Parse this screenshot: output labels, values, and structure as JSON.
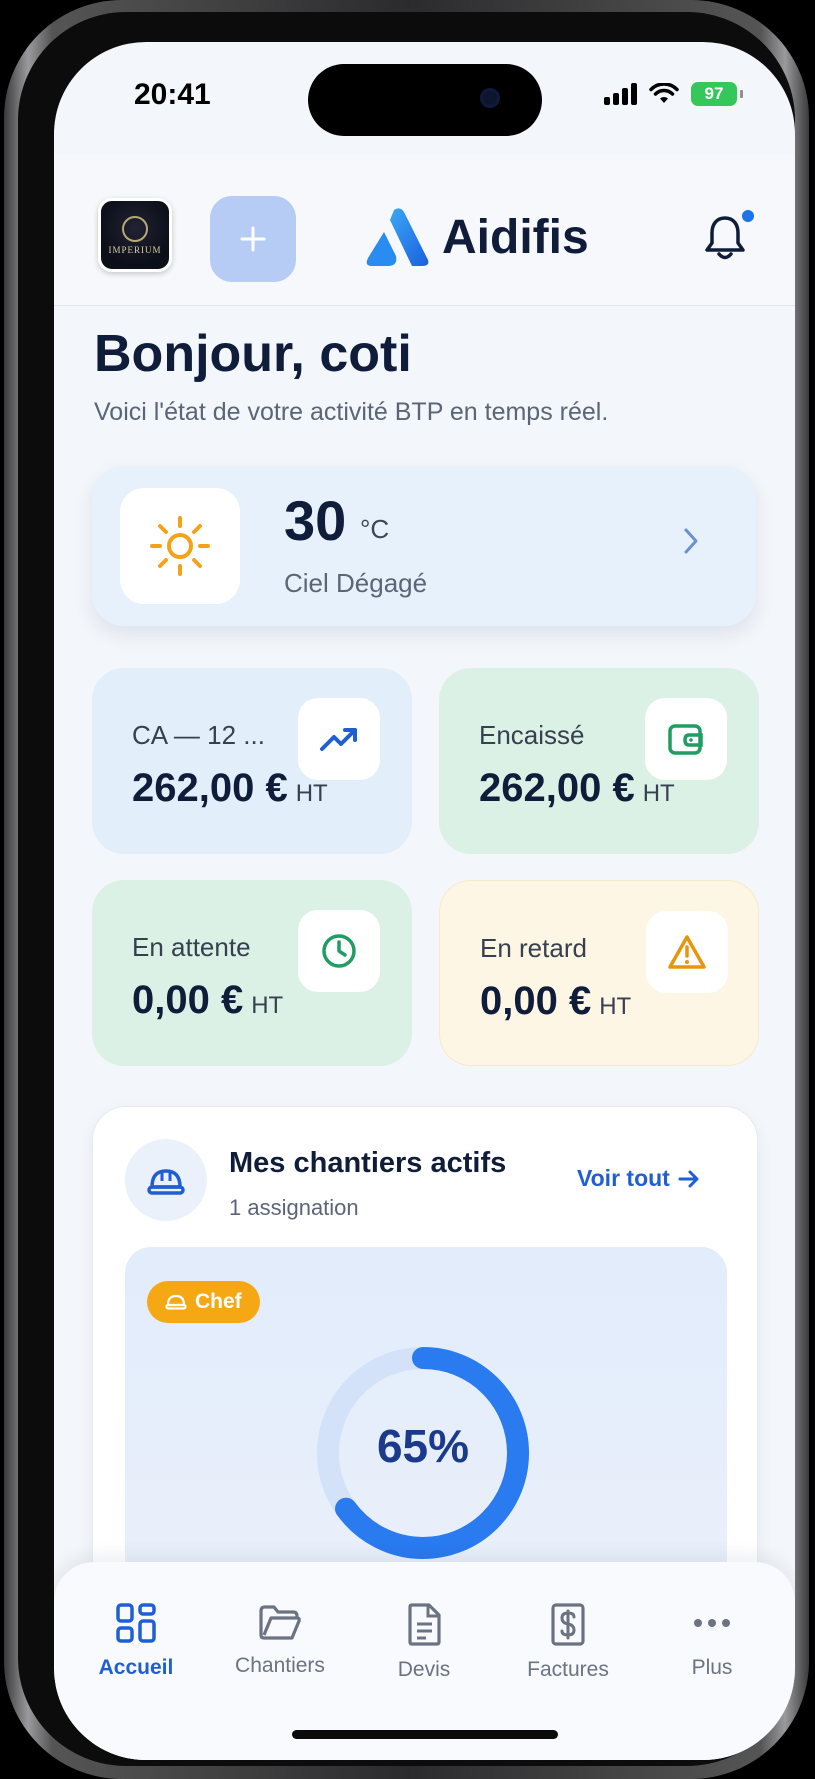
{
  "status_bar": {
    "time": "20:41",
    "battery": "97"
  },
  "header": {
    "brand_name": "Aidifis",
    "avatar_text": "IMPERIUM"
  },
  "greeting": {
    "title": "Bonjour, coti",
    "subtitle": "Voici l'état de votre activité BTP en temps réel."
  },
  "weather": {
    "temp": "30",
    "unit": "°C",
    "description": "Ciel Dégagé"
  },
  "stats": [
    {
      "label": "CA — 12 ...",
      "value": "262,00 €",
      "suffix": "HT"
    },
    {
      "label": "Encaissé",
      "value": "262,00 €",
      "suffix": "HT"
    },
    {
      "label": "En attente",
      "value": "0,00 €",
      "suffix": "HT"
    },
    {
      "label": "En retard",
      "value": "0,00 €",
      "suffix": "HT"
    }
  ],
  "sites": {
    "title": "Mes chantiers actifs",
    "subtitle": "1 assignation",
    "see_all": "Voir tout",
    "badge": "Chef",
    "progress_label": "65%",
    "progress": 0.65
  },
  "tabs": [
    {
      "label": "Accueil"
    },
    {
      "label": "Chantiers"
    },
    {
      "label": "Devis"
    },
    {
      "label": "Factures"
    },
    {
      "label": "Plus"
    }
  ],
  "colors": {
    "accent": "#1f5fd3",
    "warning": "#f5a814",
    "success": "#1f9d63"
  }
}
